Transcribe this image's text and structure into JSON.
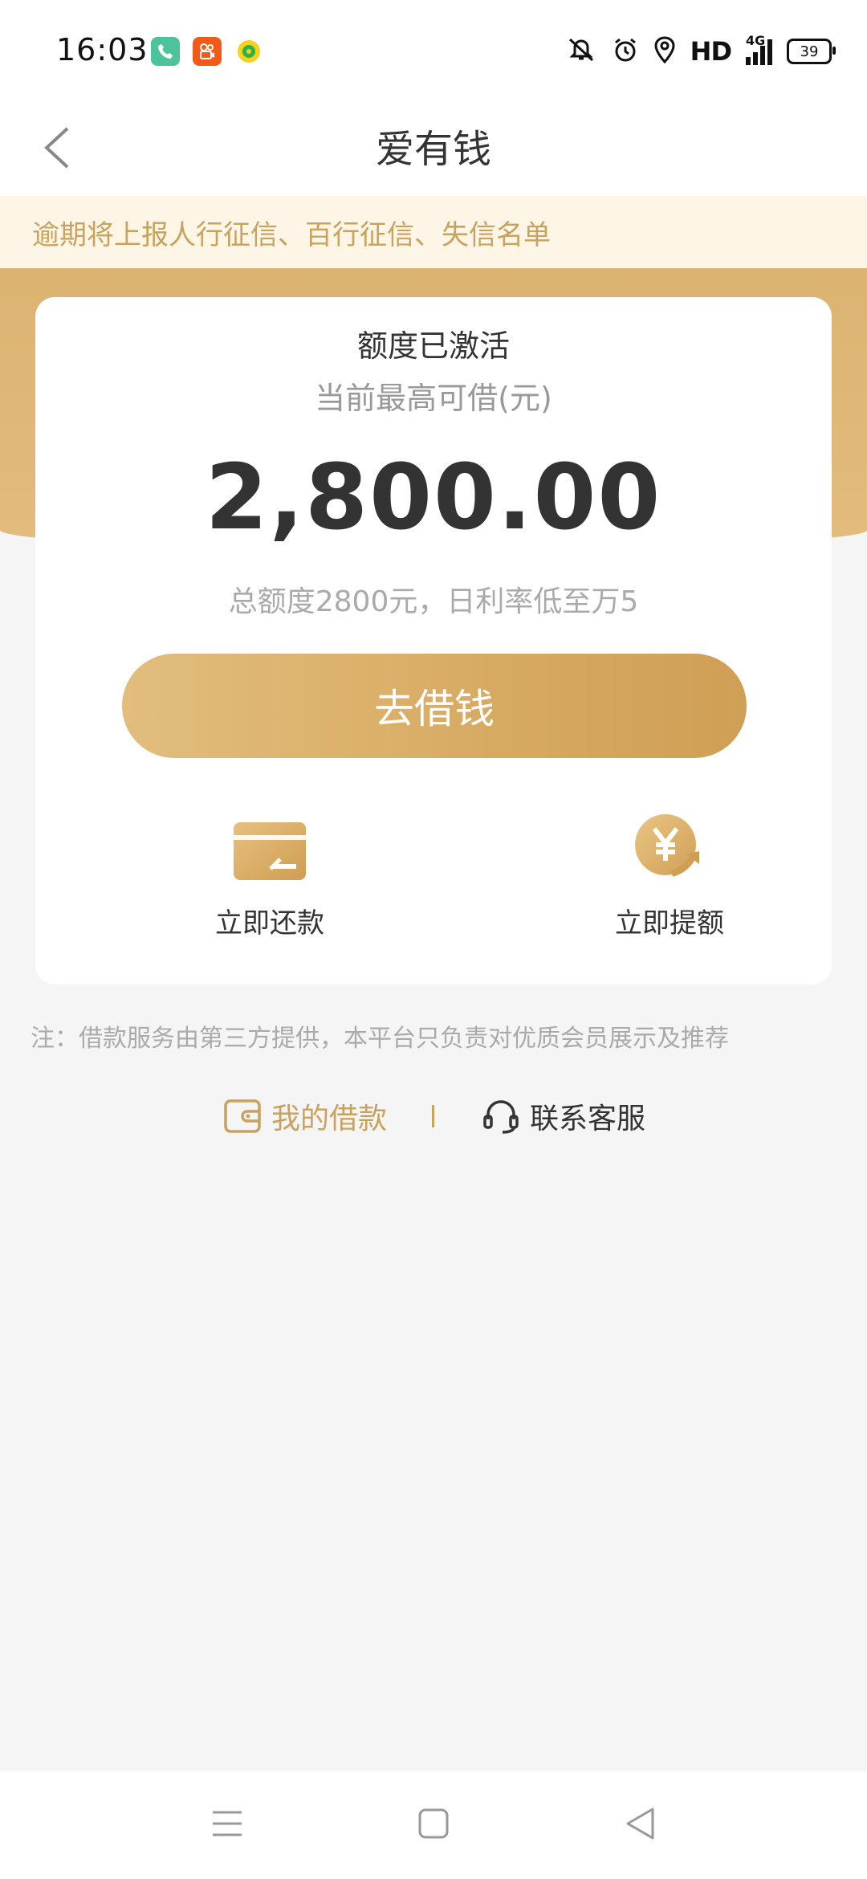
{
  "status_bar": {
    "time": "16:03",
    "network": "HD",
    "signal": "4G",
    "battery": "39",
    "app_icons": [
      "phone-icon",
      "video-app-icon",
      "music-app-icon"
    ],
    "status_icons": [
      "mute-icon",
      "alarm-icon",
      "location-icon"
    ]
  },
  "header": {
    "title": "爱有钱"
  },
  "notice": {
    "text": "逾期将上报人行征信、百行征信、失信名单"
  },
  "card": {
    "status": "额度已激活",
    "subtitle": "当前最高可借(元)",
    "amount": "2,800.00",
    "description": "总额度2800元，日利率低至万5",
    "button_label": "去借钱",
    "actions": [
      {
        "label": "立即还款",
        "icon": "repay-card-icon"
      },
      {
        "label": "立即提额",
        "icon": "yuan-increase-icon"
      }
    ]
  },
  "note": "注：借款服务由第三方提供，本平台只负责对优质会员展示及推荐",
  "links": {
    "my_loans": "我的借款",
    "customer_service": "联系客服"
  },
  "colors": {
    "gold": "#d9ae68",
    "gold_light": "#e2bd7d",
    "notice_bg": "#fdf5e5",
    "notice_text": "#c9a25e",
    "page_bg": "#f5f5f5"
  }
}
